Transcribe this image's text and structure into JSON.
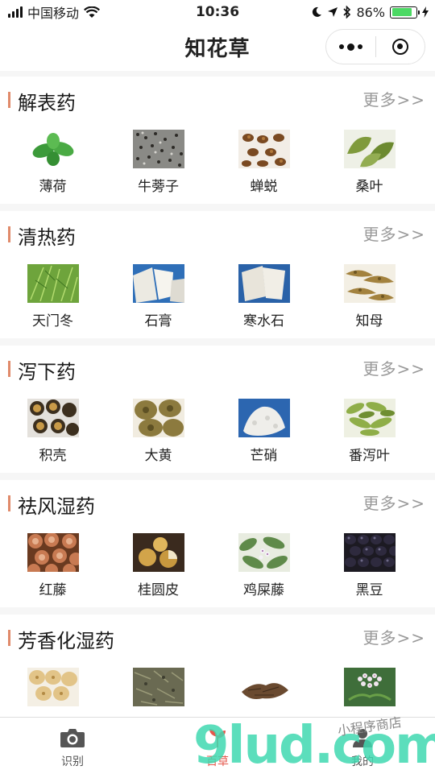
{
  "status_bar": {
    "carrier": "中国移动",
    "time": "10:36",
    "battery": "86%",
    "battery_level": 0.86
  },
  "header": {
    "title": "知花草"
  },
  "sections": [
    {
      "title": "解表药",
      "more": "更多>>",
      "items": [
        {
          "label": "薄荷",
          "icon": "mint-leaf-image"
        },
        {
          "label": "牛蒡子",
          "icon": "burdock-seed-image"
        },
        {
          "label": "蝉蜕",
          "icon": "cicada-slough-image"
        },
        {
          "label": "桑叶",
          "icon": "mulberry-leaf-image"
        }
      ]
    },
    {
      "title": "清热药",
      "more": "更多>>",
      "items": [
        {
          "label": "天门冬",
          "icon": "asparagus-image"
        },
        {
          "label": "石膏",
          "icon": "gypsum-image"
        },
        {
          "label": "寒水石",
          "icon": "calcite-image"
        },
        {
          "label": "知母",
          "icon": "anemarrhena-image"
        }
      ]
    },
    {
      "title": "泻下药",
      "more": "更多>>",
      "items": [
        {
          "label": "积壳",
          "icon": "bitter-orange-image"
        },
        {
          "label": "大黄",
          "icon": "rhubarb-image"
        },
        {
          "label": "芒硝",
          "icon": "mirabilite-image"
        },
        {
          "label": "番泻叶",
          "icon": "senna-leaf-image"
        }
      ]
    },
    {
      "title": "祛风湿药",
      "more": "更多>>",
      "items": [
        {
          "label": "红藤",
          "icon": "sargentodoxa-image"
        },
        {
          "label": "桂圆皮",
          "icon": "longan-peel-image"
        },
        {
          "label": "鸡屎藤",
          "icon": "paederia-image"
        },
        {
          "label": "黑豆",
          "icon": "black-bean-image"
        }
      ]
    },
    {
      "title": "芳香化湿药",
      "more": "更多>>",
      "items": [
        {
          "label": "",
          "icon": "nut-image"
        },
        {
          "label": "",
          "icon": "dried-herb-image"
        },
        {
          "label": "",
          "icon": "bark-pile-image"
        },
        {
          "label": "",
          "icon": "flower-cluster-image"
        }
      ]
    }
  ],
  "tabbar": {
    "tabs": [
      {
        "label": "识别",
        "icon": "camera-icon"
      },
      {
        "label": "百草",
        "icon": "herb-icon",
        "active": true
      },
      {
        "label": "我的",
        "icon": "profile-icon"
      }
    ]
  },
  "watermark": {
    "text": "9lud.com",
    "sub": "小程序商店"
  },
  "colors": {
    "accent": "#e08a6a",
    "active_tab": "#e4574c",
    "battery": "#4cd964"
  }
}
